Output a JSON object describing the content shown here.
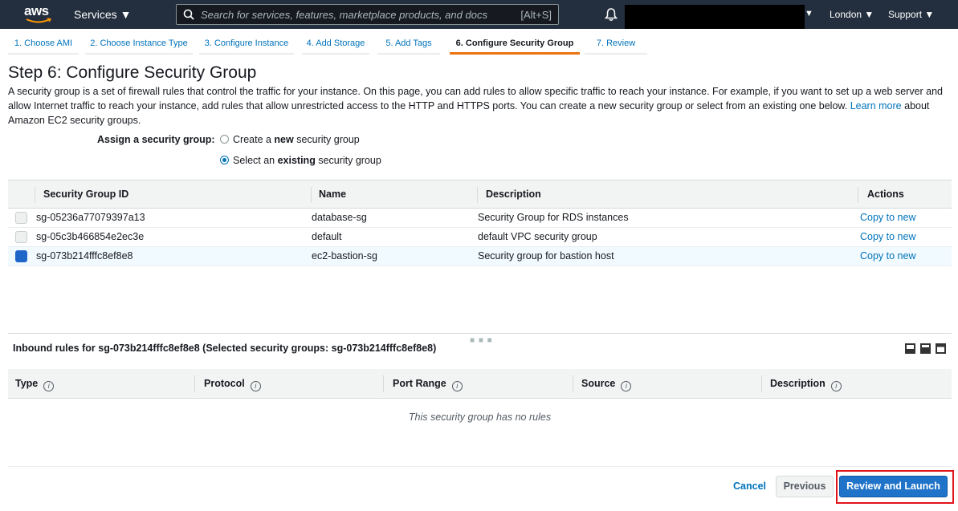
{
  "topnav": {
    "logo": "aws",
    "services_label": "Services ▼",
    "search_placeholder": "Search for services, features, marketplace products, and docs",
    "search_shortcut": "[Alt+S]",
    "account_caret": "▼",
    "region_label": "London ▼",
    "support_label": "Support ▼",
    "colors": {
      "background": "#232f3e",
      "accent": "#ec7211"
    }
  },
  "steps": [
    {
      "label": "1. Choose AMI"
    },
    {
      "label": "2. Choose Instance Type"
    },
    {
      "label": "3. Configure Instance"
    },
    {
      "label": "4. Add Storage"
    },
    {
      "label": "5. Add Tags"
    },
    {
      "label": "6. Configure Security Group"
    },
    {
      "label": "7. Review"
    }
  ],
  "page": {
    "title": "Step 6: Configure Security Group",
    "intro_before_link": "A security group is a set of firewall rules that control the traffic for your instance. On this page, you can add rules to allow specific traffic to reach your instance. For example, if you want to set up a web server and allow Internet traffic to reach your instance, add rules that allow unrestricted access to the HTTP and HTTPS ports. You can create a new security group or select from an existing one below.",
    "intro_link": "Learn more",
    "intro_after_link": "about Amazon EC2 security groups.",
    "assign_label": "Assign a security group:",
    "option_create": {
      "pre": "Create a ",
      "bold": "new",
      "post": " security group"
    },
    "option_existing": {
      "pre": "Select an ",
      "bold": "existing",
      "post": " security group"
    }
  },
  "sg_table": {
    "headers": [
      "Security Group ID",
      "Name",
      "Description",
      "Actions"
    ],
    "rows": [
      {
        "id": "sg-05236a77079397a13",
        "name": "database-sg",
        "description": "Security Group for RDS instances",
        "action": "Copy to new",
        "checked": false
      },
      {
        "id": "sg-05c3b466854e2ec3e",
        "name": "default",
        "description": "default VPC security group",
        "action": "Copy to new",
        "checked": false
      },
      {
        "id": "sg-073b214fffc8ef8e8",
        "name": "ec2-bastion-sg",
        "description": "Security group for bastion host",
        "action": "Copy to new",
        "checked": true
      }
    ]
  },
  "inbound": {
    "title": "Inbound rules for sg-073b214fffc8ef8e8 (Selected security groups: sg-073b214fffc8ef8e8)",
    "headers": [
      "Type",
      "Protocol",
      "Port Range",
      "Source",
      "Description"
    ],
    "info_glyph": "i",
    "empty_text": "This security group has no rules"
  },
  "footer": {
    "cancel_label": "Cancel",
    "previous_label": "Previous",
    "review_launch_label": "Review and Launch"
  }
}
